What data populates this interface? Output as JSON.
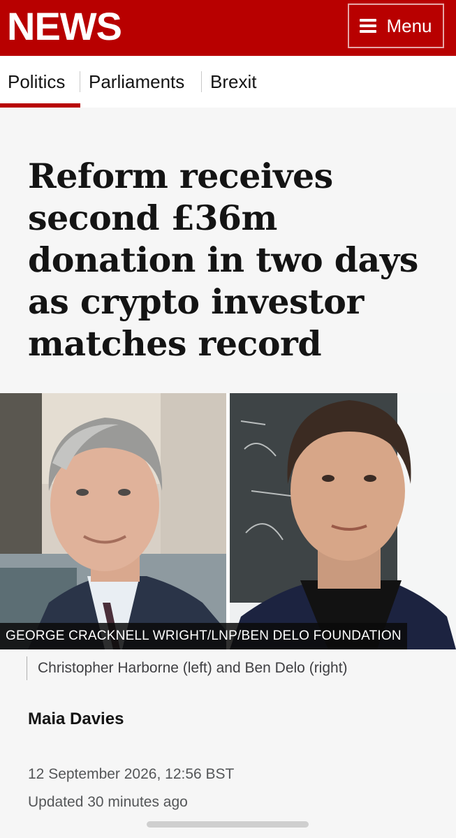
{
  "header": {
    "logo": "NEWS",
    "menu_label": "Menu",
    "brand_color": "#b80000"
  },
  "subnav": {
    "items": [
      {
        "label": "Politics",
        "active": true
      },
      {
        "label": "Parliaments",
        "active": false
      },
      {
        "label": "Brexit",
        "active": false
      }
    ]
  },
  "article": {
    "headline": "Reform receives second £36m donation in two days as crypto investor matches record",
    "image_credit": "GEORGE CRACKNELL WRIGHT/LNP/BEN DELO FOUNDATION",
    "image_caption": "Christopher Harborne (left) and Ben Delo (right)",
    "author": "Maia Davies",
    "date": "12 September 2026, 12:56 BST",
    "updated": "Updated 30 minutes ago"
  },
  "icons": {
    "menu": "hamburger-icon"
  }
}
